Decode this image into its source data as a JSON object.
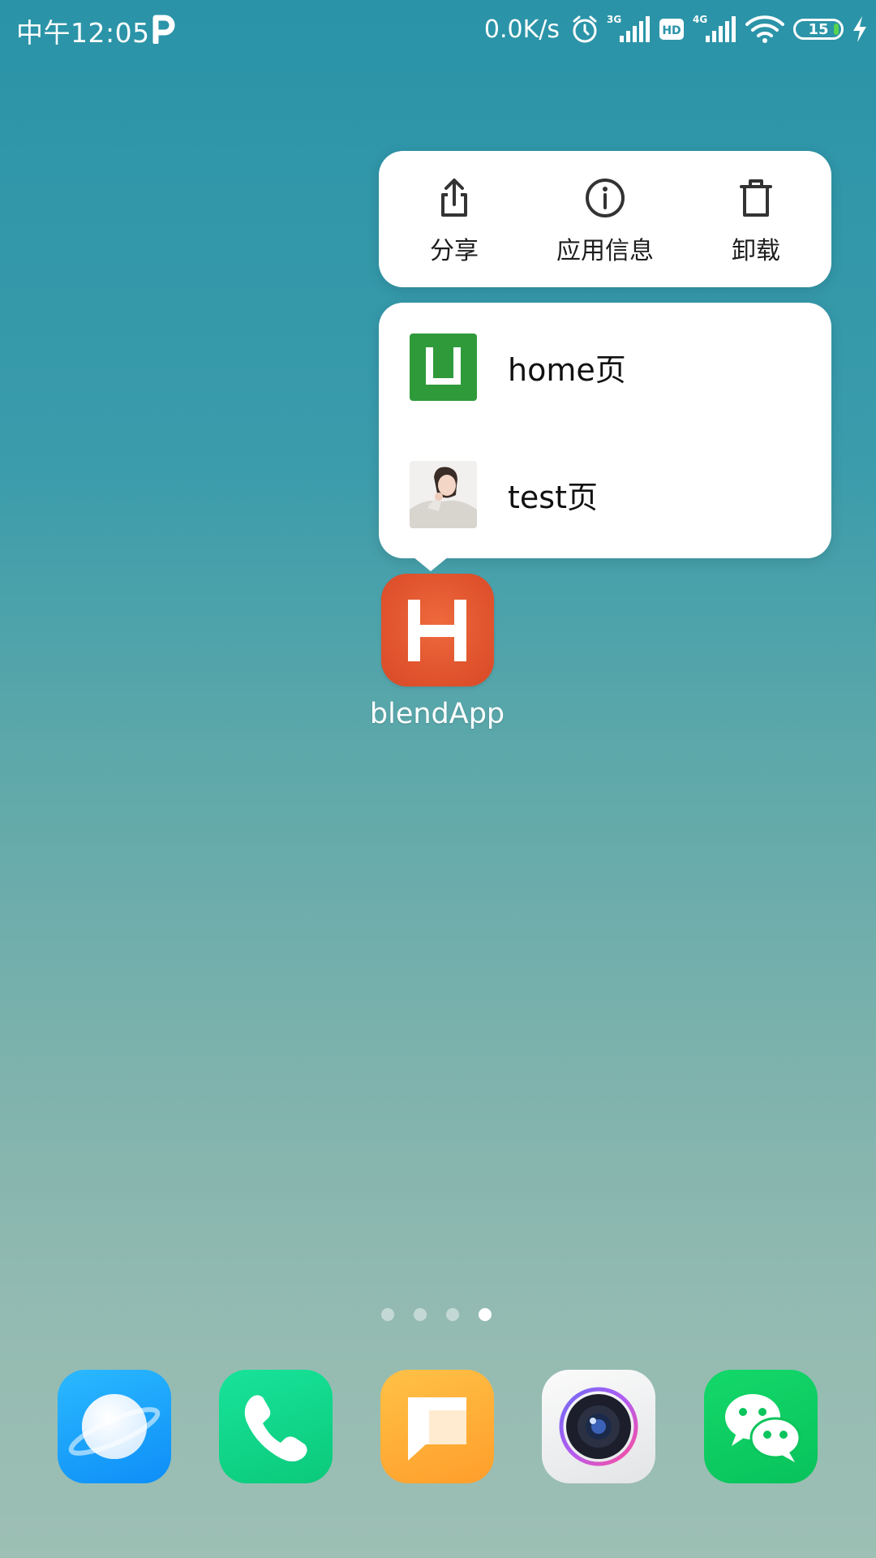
{
  "status_bar": {
    "time": "中午12:05",
    "net_speed": "0.0K/s",
    "sim1_type": "3G",
    "hd_label": "HD",
    "sim2_type": "4G",
    "battery": "15"
  },
  "popup_actions": [
    {
      "label": "分享",
      "icon": "share-icon"
    },
    {
      "label": "应用信息",
      "icon": "info-icon"
    },
    {
      "label": "卸载",
      "icon": "trash-icon"
    }
  ],
  "shortcuts": [
    {
      "label": "home页",
      "icon": "green-u-icon"
    },
    {
      "label": "test页",
      "icon": "photo-thumbnail"
    }
  ],
  "app": {
    "label": "blendApp",
    "icon": "h-app-icon"
  },
  "page_indicator": {
    "count": 4,
    "active": 4
  },
  "dock": [
    {
      "icon": "browser-icon"
    },
    {
      "icon": "phone-icon"
    },
    {
      "icon": "messages-icon"
    },
    {
      "icon": "camera-icon"
    },
    {
      "icon": "wechat-icon"
    }
  ],
  "colors": {
    "app_icon": "#e0542e",
    "shortcut_green": "#2f9a3a",
    "battery_fill": "#57d34d"
  }
}
